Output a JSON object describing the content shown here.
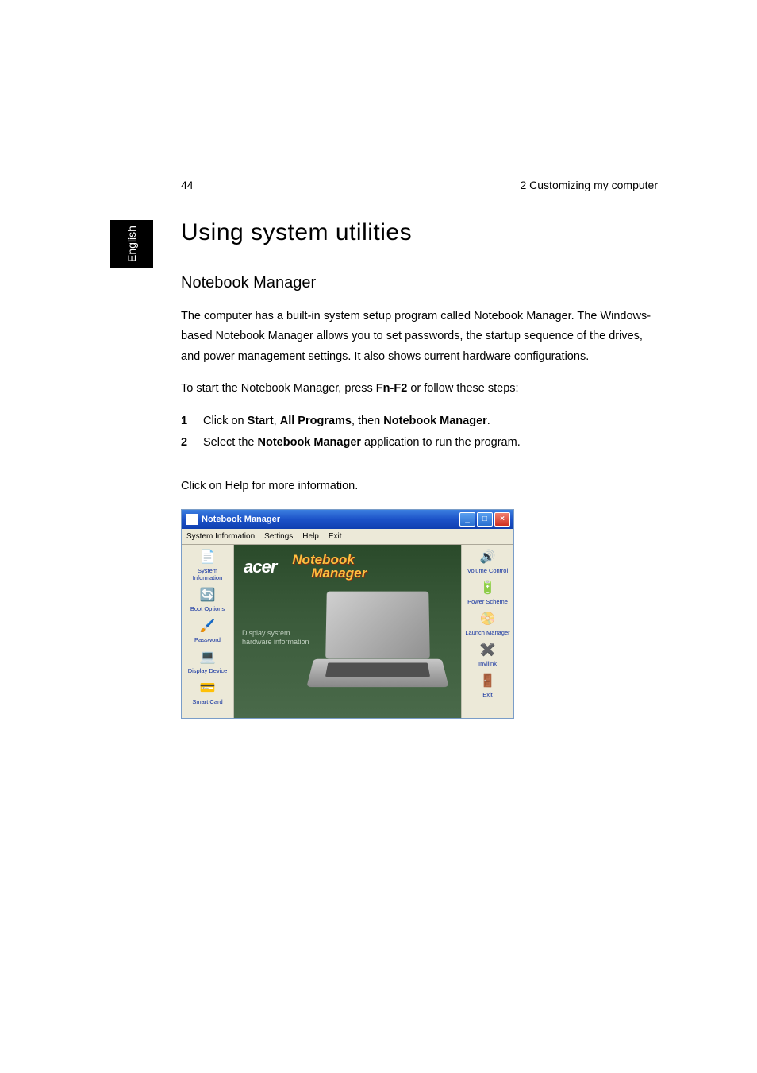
{
  "page_number": "44",
  "chapter_header": "2 Customizing my computer",
  "language_tab": "English",
  "heading_1": "Using system utilities",
  "heading_2": "Notebook Manager",
  "paragraph_1": "The computer has a built-in system setup program called Notebook Manager. The Windows-based Notebook Manager allows you to set passwords, the startup sequence of the drives, and power management settings. It also shows current hardware configurations.",
  "paragraph_2_pre": "To start the Notebook Manager, press ",
  "paragraph_2_bold": "Fn-F2",
  "paragraph_2_post": " or follow these steps:",
  "list": [
    {
      "num": "1",
      "pre": "Click on ",
      "b1": "Start",
      "mid1": ", ",
      "b2": "All Programs",
      "mid2": ", then ",
      "b3": "Notebook Manager",
      "post": "."
    },
    {
      "num": "2",
      "pre": "Select the ",
      "b1": "Notebook Manager",
      "mid1": " application to run the program.",
      "b2": "",
      "mid2": "",
      "b3": "",
      "post": ""
    }
  ],
  "paragraph_3": "Click on Help for more information.",
  "app_window": {
    "title": "Notebook Manager",
    "menu": [
      "System Information",
      "Settings",
      "Help",
      "Exit"
    ],
    "left_sidebar": [
      {
        "label": "System Information",
        "icon": "📄"
      },
      {
        "label": "Boot Options",
        "icon": "🔄"
      },
      {
        "label": "Password",
        "icon": "🖌️"
      },
      {
        "label": "Display Device",
        "icon": "💻"
      },
      {
        "label": "Smart Card",
        "icon": "💳"
      }
    ],
    "right_sidebar": [
      {
        "label": "Volume Control",
        "icon": "🔊"
      },
      {
        "label": "Power Scheme",
        "icon": "🔋"
      },
      {
        "label": "Launch Manager",
        "icon": "📀"
      },
      {
        "label": "Invilink",
        "icon": "✖️"
      },
      {
        "label": "Exit",
        "icon": "🚪"
      }
    ],
    "brand": "acer",
    "product_line1": "Notebook",
    "product_line2": "Manager",
    "center_caption_line1": "Display system",
    "center_caption_line2": "hardware information"
  }
}
